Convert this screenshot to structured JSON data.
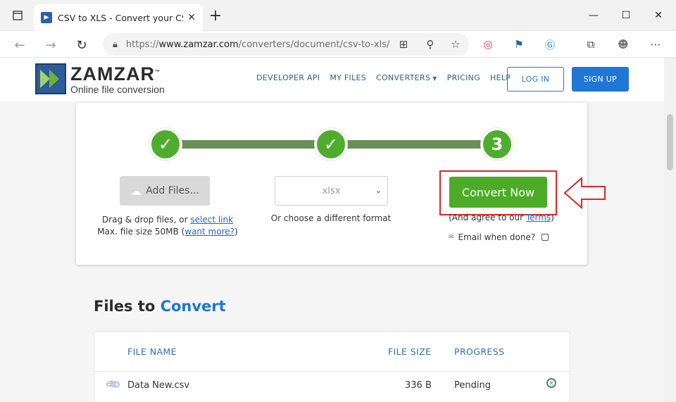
{
  "browser": {
    "tab_title": "CSV to XLS - Convert your CSV to",
    "tab_close": "✕",
    "new_tab": "+",
    "url_prefix": "https://",
    "url_host": "www.zamzar.com",
    "url_path": "/converters/document/csv-to-xls/",
    "window_minimize": "—",
    "window_maximize": "☐",
    "window_close": "✕"
  },
  "site": {
    "logo_name": "ZAMZAR",
    "logo_tm": "™",
    "logo_tagline": "Online file conversion",
    "nav": [
      "DEVELOPER API",
      "MY FILES",
      "CONVERTERS",
      "PRICING",
      "HELP"
    ],
    "login": "LOG IN",
    "signup": "SIGN UP"
  },
  "converter": {
    "steps": [
      "✓",
      "✓",
      "3"
    ],
    "add_files": "Add Files...",
    "drag_drop_text": "Drag & drop files, or",
    "select_link": "select link",
    "max_size_text": "Max. file size 50MB (",
    "want_more": "want more?",
    "max_size_close": ")",
    "format_value": "xlsx",
    "format_hint": "Or choose a different format",
    "convert_label": "Convert Now",
    "agree_text": "(And agree to our",
    "terms_link": "Terms",
    "agree_close": ")",
    "email_label": "Email when done?"
  },
  "files": {
    "title_plain": "Files to",
    "title_accent": "Convert",
    "headers": {
      "name": "FILE NAME",
      "size": "FILE SIZE",
      "progress": "PROGRESS"
    },
    "rows": [
      {
        "name": "Data New.csv",
        "size": "336 B",
        "progress": "Pending"
      }
    ]
  },
  "colors": {
    "accent_blue": "#1f76d4",
    "convert_green": "#4cab27",
    "highlight_red": "#e02424"
  }
}
